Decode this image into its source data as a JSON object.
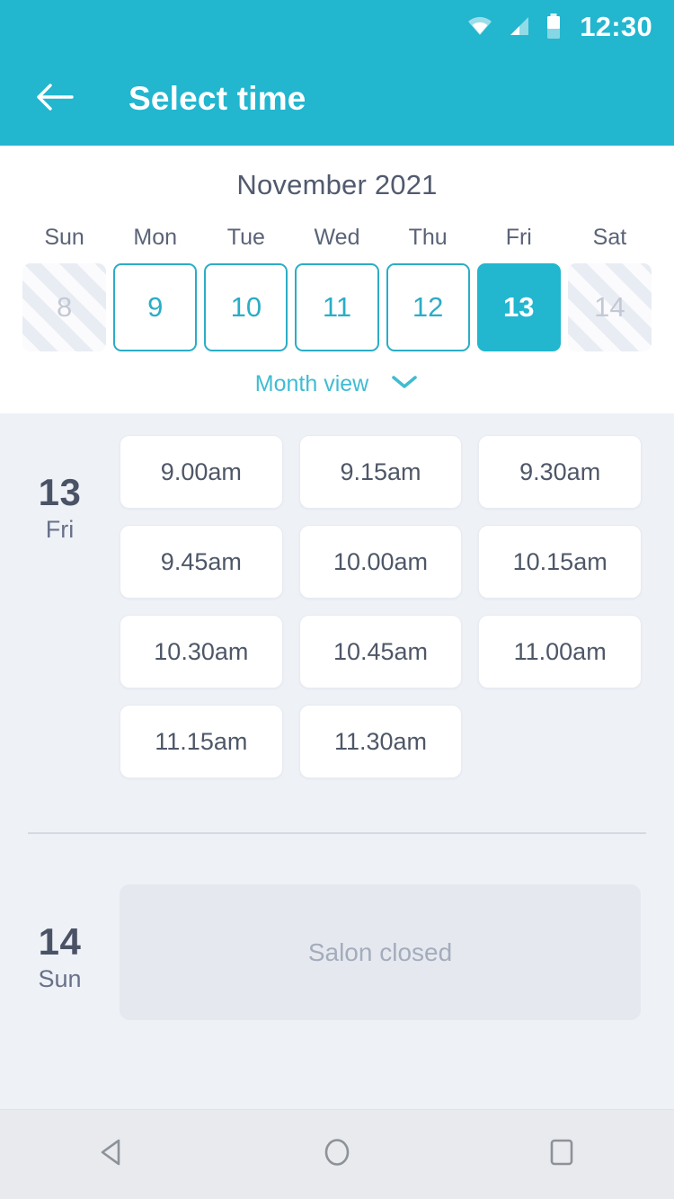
{
  "statusbar": {
    "clock": "12:30",
    "icons": [
      "wifi-icon",
      "signal-icon",
      "battery-icon"
    ]
  },
  "appbar": {
    "back_icon": "arrow-left-icon",
    "title": "Select time"
  },
  "calendar": {
    "month_title": "November 2021",
    "weekday_headers": [
      "Sun",
      "Mon",
      "Tue",
      "Wed",
      "Thu",
      "Fri",
      "Sat"
    ],
    "days": [
      {
        "num": "8",
        "state": "disabled"
      },
      {
        "num": "9",
        "state": "available"
      },
      {
        "num": "10",
        "state": "available"
      },
      {
        "num": "11",
        "state": "available"
      },
      {
        "num": "12",
        "state": "available"
      },
      {
        "num": "13",
        "state": "selected"
      },
      {
        "num": "14",
        "state": "disabled"
      }
    ],
    "month_view_label": "Month view",
    "month_view_icon": "chevron-down-icon"
  },
  "schedule": [
    {
      "date_num": "13",
      "date_dow": "Fri",
      "slots": [
        "9.00am",
        "9.15am",
        "9.30am",
        "9.45am",
        "10.00am",
        "10.15am",
        "10.30am",
        "10.45am",
        "11.00am",
        "11.15am",
        "11.30am"
      ]
    }
  ],
  "closed_day": {
    "date_num": "14",
    "date_dow": "Sun",
    "message": "Salon closed"
  },
  "navbar": {
    "back_icon": "triangle-back-icon",
    "home_icon": "circle-home-icon",
    "recents_icon": "square-recents-icon"
  },
  "colors": {
    "accent": "#22b6cf",
    "accent_border": "#2badc6",
    "page_bg": "#eef1f6",
    "card_bg": "#ffffff",
    "text_dark": "#4a5366",
    "text_muted": "#a4acbc"
  }
}
